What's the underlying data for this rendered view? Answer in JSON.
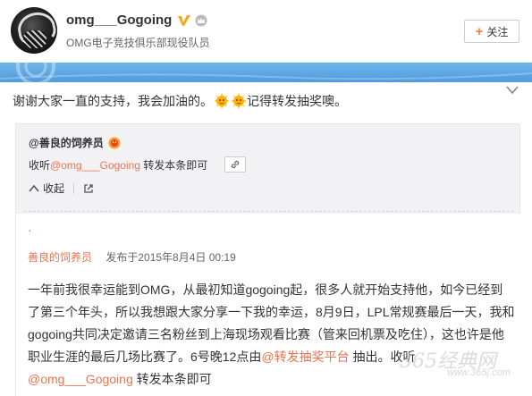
{
  "user": {
    "name": "omg___Gogoing",
    "description": "OMG电子竞技俱乐部现役队员",
    "follow_label": "关注",
    "follow_icon": "plus-icon",
    "verified_color": "#f5a623"
  },
  "post": {
    "text_before": "谢谢大家一直的支持，我会加油的。",
    "text_after": "记得转发抽奖噢。",
    "emojis": [
      "sun-smile-emoji",
      "sun-smile-emoji"
    ]
  },
  "repost": {
    "author": "@善良的饲养员",
    "text_prefix": "收听",
    "mention": "@omg___Gogoing",
    "text_suffix": " 转发本条即可",
    "actions": {
      "collapse": "收起",
      "view_original": "查看原文"
    }
  },
  "article": {
    "dot": "·",
    "author": "善良的饲养员",
    "time": "发布于2015年8月4日 00:19",
    "paragraph_part1": "一年前我很幸运能到OMG，从最初知道gogoing起，很多人就开始支持他，如今已经到了第三个年头，所以我想跟大家分享一下我的幸运，8月9日，LPL常规赛最后一天，我和gogoing共同决定邀请三名粉丝到上海现场观看比赛（管来回机票及吃住），这也许是他职业生涯的最后几场比赛了。6号晚12点由",
    "topic": "@转发抽奖平台",
    "paragraph_part2": " 抽出。收听",
    "mention": "@omg___Gogoing",
    "paragraph_part3": " 转发本条即可"
  },
  "watermark": {
    "main": "365经典网",
    "sub": "www.365j.com"
  },
  "colors": {
    "accent": "#eb7350",
    "banner": "#5ea6e3",
    "repost_bg": "#f2f2f5"
  }
}
